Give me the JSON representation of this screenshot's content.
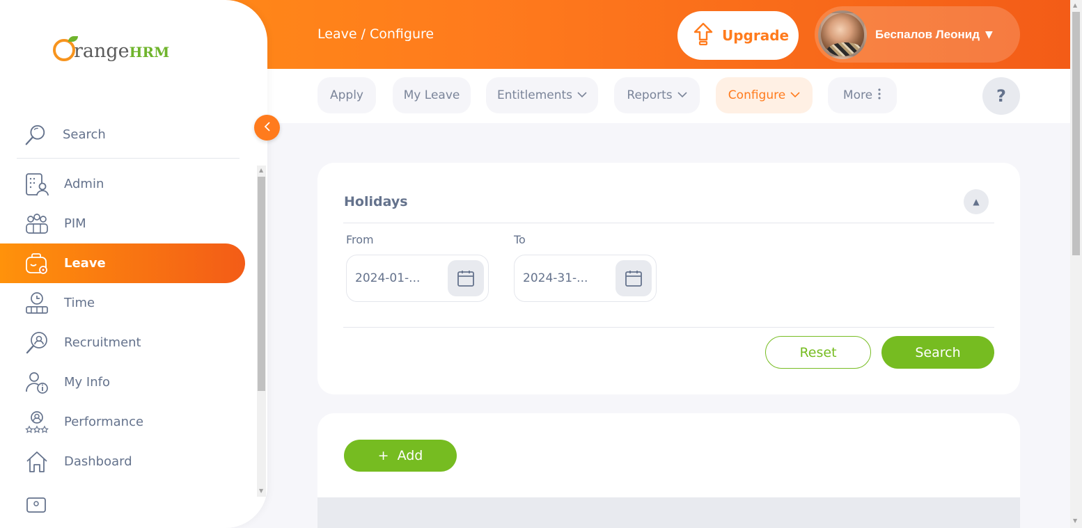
{
  "header": {
    "breadcrumb": "Leave / Configure",
    "upgrade_label": "Upgrade",
    "user_name": "Беспалов Леонид"
  },
  "logo": {
    "part1": "range",
    "part2": "HRM"
  },
  "subnav": {
    "tabs": [
      {
        "label": "Apply",
        "has_dropdown": false
      },
      {
        "label": "My Leave",
        "has_dropdown": false
      },
      {
        "label": "Entitlements",
        "has_dropdown": true
      },
      {
        "label": "Reports",
        "has_dropdown": true
      },
      {
        "label": "Configure",
        "has_dropdown": true,
        "active": true
      },
      {
        "label": "More",
        "has_dropdown": true
      }
    ],
    "help_label": "?"
  },
  "sidebar": {
    "search_label": "Search",
    "items": [
      {
        "label": "Admin",
        "icon": "admin-icon"
      },
      {
        "label": "PIM",
        "icon": "pim-icon"
      },
      {
        "label": "Leave",
        "icon": "leave-icon",
        "active": true
      },
      {
        "label": "Time",
        "icon": "time-icon"
      },
      {
        "label": "Recruitment",
        "icon": "recruitment-icon"
      },
      {
        "label": "My Info",
        "icon": "my-info-icon"
      },
      {
        "label": "Performance",
        "icon": "performance-icon"
      },
      {
        "label": "Dashboard",
        "icon": "dashboard-icon"
      }
    ]
  },
  "filter": {
    "title": "Holidays",
    "from_label": "From",
    "from_value": "2024-01-...",
    "to_label": "To",
    "to_value": "2024-31-...",
    "reset_label": "Reset",
    "search_label": "Search"
  },
  "results": {
    "add_label": "Add",
    "add_icon": "+"
  },
  "colors": {
    "brand_orange": "#ff7b1d",
    "brand_green": "#76bc21",
    "text_gray": "#64728c"
  }
}
